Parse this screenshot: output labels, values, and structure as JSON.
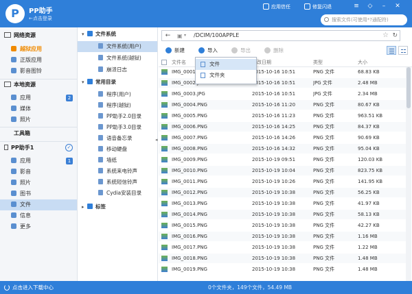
{
  "header": {
    "app_title": "PP助手",
    "app_subtitle": "←点击登录",
    "actions": [
      {
        "label": "应用信任",
        "icon": "shield-icon"
      },
      {
        "label": "修复闪退",
        "icon": "wrench-icon"
      }
    ],
    "search_placeholder": "搜索文件(可使用*?通配符)"
  },
  "sidebar": {
    "sections": [
      {
        "label": "网络资源",
        "items": [
          {
            "label": "越狱应用",
            "icon": "jailbreak-apps-icon",
            "highlight": true
          },
          {
            "label": "正版应用",
            "icon": "apps-icon"
          },
          {
            "label": "影音图铃",
            "icon": "music-icon"
          }
        ]
      },
      {
        "label": "本地资源",
        "items": [
          {
            "label": "应用",
            "icon": "app-grid-icon",
            "badge": "2"
          },
          {
            "label": "媒体",
            "icon": "media-icon"
          },
          {
            "label": "照片",
            "icon": "photo-icon"
          }
        ]
      },
      {
        "label": "工具箱",
        "items": []
      },
      {
        "label": "PP助手1",
        "items": [
          {
            "label": "应用",
            "icon": "app-grid-icon",
            "badge": "1"
          },
          {
            "label": "影音",
            "icon": "music-icon"
          },
          {
            "label": "照片",
            "icon": "photo-icon"
          },
          {
            "label": "图书",
            "icon": "book-icon"
          },
          {
            "label": "文件",
            "icon": "folder-icon",
            "active": true
          },
          {
            "label": "信息",
            "icon": "message-icon"
          },
          {
            "label": "更多",
            "icon": "more-icon"
          }
        ]
      }
    ]
  },
  "tree": {
    "filesystem_heading": "文件系统",
    "filesystem_items": [
      "文件系统(用户)",
      "文件系统(越狱)",
      "崩溃日志"
    ],
    "common_heading": "常用目录",
    "common_items": [
      "程序(用户)",
      "程序(越狱)",
      "PP助手2.0目录",
      "PP助手3.0目录",
      "语音备忘录",
      "移动硬盘",
      "墙纸",
      "系统来电铃声",
      "系统短信铃声",
      "Cydia安装目录"
    ],
    "bookmarks_heading": "标签"
  },
  "address_bar": {
    "path": "/DCIM/100APPLE"
  },
  "toolbar": {
    "new_label": "新建",
    "import_label": "导入",
    "export_label": "导出",
    "delete_label": "删除"
  },
  "dropdown": {
    "items": [
      "文件",
      "文件夹"
    ]
  },
  "table": {
    "columns": [
      "文件名",
      "修改日期",
      "类型",
      "大小"
    ],
    "rows": [
      [
        "IMG_0001.PNG",
        "2015-10-16 10:51",
        "PNG 文件",
        "68.83 KB"
      ],
      [
        "IMG_0002.JPG",
        "2015-10-16 10:51",
        "JPG 文件",
        "2.48 MB"
      ],
      [
        "IMG_0003.JPG",
        "2015-10-16 10:51",
        "JPG 文件",
        "2.34 MB"
      ],
      [
        "IMG_0004.PNG",
        "2015-10-16 11:20",
        "PNG 文件",
        "80.67 KB"
      ],
      [
        "IMG_0005.PNG",
        "2015-10-16 11:23",
        "PNG 文件",
        "963.51 KB"
      ],
      [
        "IMG_0006.PNG",
        "2015-10-16 14:25",
        "PNG 文件",
        "84.37 KB"
      ],
      [
        "IMG_0007.PNG",
        "2015-10-16 14:26",
        "PNG 文件",
        "90.69 KB"
      ],
      [
        "IMG_0008.PNG",
        "2015-10-16 14:32",
        "PNG 文件",
        "95.04 KB"
      ],
      [
        "IMG_0009.PNG",
        "2015-10-19 09:51",
        "PNG 文件",
        "120.03 KB"
      ],
      [
        "IMG_0010.PNG",
        "2015-10-19 10:04",
        "PNG 文件",
        "823.75 KB"
      ],
      [
        "IMG_0011.PNG",
        "2015-10-19 10:26",
        "PNG 文件",
        "141.95 KB"
      ],
      [
        "IMG_0012.PNG",
        "2015-10-19 10:38",
        "PNG 文件",
        "56.25 KB"
      ],
      [
        "IMG_0013.PNG",
        "2015-10-19 10:38",
        "PNG 文件",
        "41.97 KB"
      ],
      [
        "IMG_0014.PNG",
        "2015-10-19 10:38",
        "PNG 文件",
        "58.13 KB"
      ],
      [
        "IMG_0015.PNG",
        "2015-10-19 10:38",
        "PNG 文件",
        "42.27 KB"
      ],
      [
        "IMG_0016.PNG",
        "2015-10-19 10:38",
        "PNG 文件",
        "1.16 MB"
      ],
      [
        "IMG_0017.PNG",
        "2015-10-19 10:38",
        "PNG 文件",
        "1.22 MB"
      ],
      [
        "IMG_0018.PNG",
        "2015-10-19 10:38",
        "PNG 文件",
        "1.48 MB"
      ],
      [
        "IMG_0019.PNG",
        "2015-10-19 10:38",
        "PNG 文件",
        "1.48 MB"
      ]
    ]
  },
  "statusbar": {
    "left_label": "点击进入下载中心",
    "summary": "0个文件夹，149个文件，54.49 MB"
  },
  "colors": {
    "accent": "#2f7fd9",
    "highlight_orange": "#f08a00",
    "selection": "#c8dcf3"
  }
}
